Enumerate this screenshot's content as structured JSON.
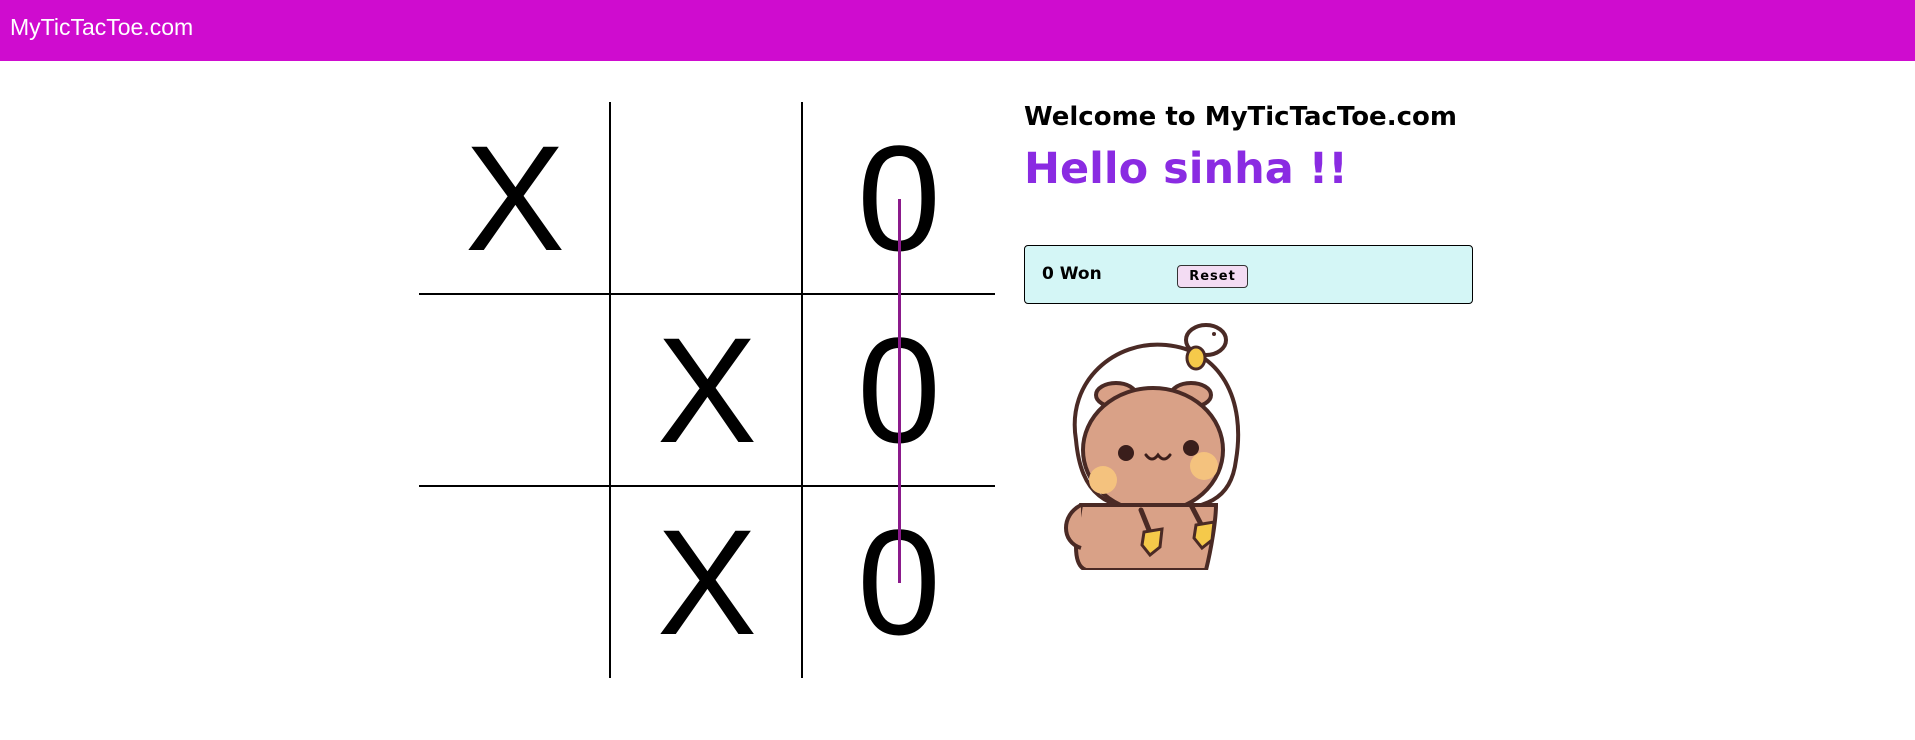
{
  "navbar": {
    "brand": "MyTicTacToe.com",
    "color": "#cf0ccf"
  },
  "board": {
    "cells": [
      "X",
      "",
      "0",
      "",
      "X",
      "0",
      "",
      "X",
      "0"
    ],
    "winning_line": {
      "cells": [
        2,
        5,
        8
      ],
      "color": "#8b1a8b"
    }
  },
  "panel": {
    "welcome": "Welcome to MyTicTacToe.com",
    "greeting": "Hello sinha !!",
    "greeting_color": "#8a2be2",
    "score": {
      "text": "0 Won",
      "background": "#d4f6f6"
    },
    "reset_label": "Reset"
  },
  "sticker": {
    "icon": "bear-astronaut-sticker-icon"
  }
}
